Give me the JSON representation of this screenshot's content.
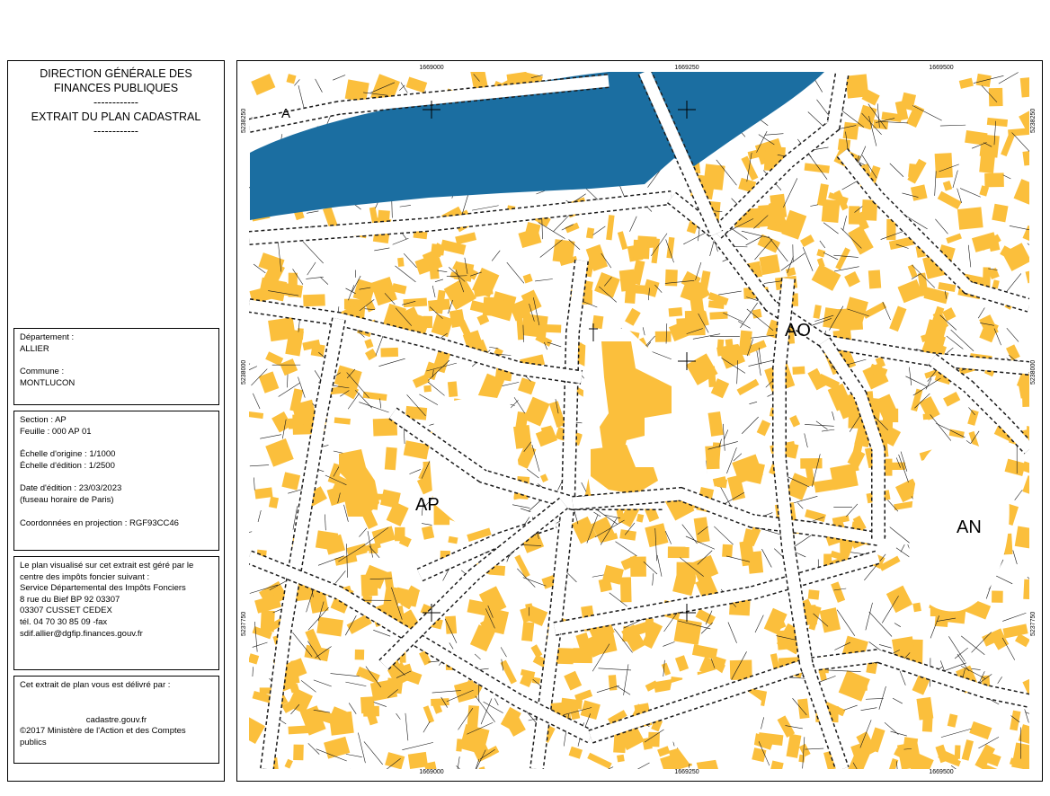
{
  "header": {
    "line1": "DIRECTION GÉNÉRALE DES",
    "line2": "FINANCES PUBLIQUES",
    "sep": "------------",
    "line3": "EXTRAIT DU PLAN CADASTRAL",
    "sep2": "------------"
  },
  "location": {
    "dept_label": "Département :",
    "dept": "ALLIER",
    "commune_label": "Commune :",
    "commune": "MONTLUCON"
  },
  "sheet": {
    "section": "Section : AP",
    "feuille": "Feuille : 000 AP 01",
    "echelle_origine": "Échelle d'origine : 1/1000",
    "echelle_edition": "Échelle d'édition : 1/2500",
    "date_edition": "Date d'édition : 23/03/2023",
    "fuseau": "(fuseau horaire de Paris)",
    "coordonnees": "Coordonnées en projection : RGF93CC46"
  },
  "service": {
    "l1": "Le plan visualisé sur cet extrait est géré par le",
    "l2": "centre des impôts foncier suivant :",
    "l3": "Service Départemental des Impôts Fonciers",
    "l4": "8 rue du Bief BP 92 03307",
    "l5": "03307 CUSSET CEDEX",
    "l6": "tél. 04 70 30 85 09 -fax",
    "l7": "sdif.allier@dgfip.finances.gouv.fr"
  },
  "delivery": {
    "l1": "Cet extrait de plan vous est délivré par :",
    "l2": "cadastre.gouv.fr",
    "l3": "©2017 Ministère de l'Action et des Comptes",
    "l4": "publics"
  },
  "map": {
    "x_top": [
      "1669000",
      "1669250",
      "1669500"
    ],
    "x_bottom": [
      "1669000",
      "1669250",
      "1669500"
    ],
    "y_left": [
      "5238250",
      "5238000",
      "5237750"
    ],
    "y_right": [
      "5238250",
      "5238000",
      "5237750"
    ],
    "sections": [
      "AP",
      "AO",
      "AN",
      "A"
    ],
    "colors": {
      "building": "#fbbf3c",
      "water": "#1b6ea1",
      "road": "#ffffff",
      "parcel": "#1a1a1a",
      "plot": "#ffffff"
    }
  }
}
